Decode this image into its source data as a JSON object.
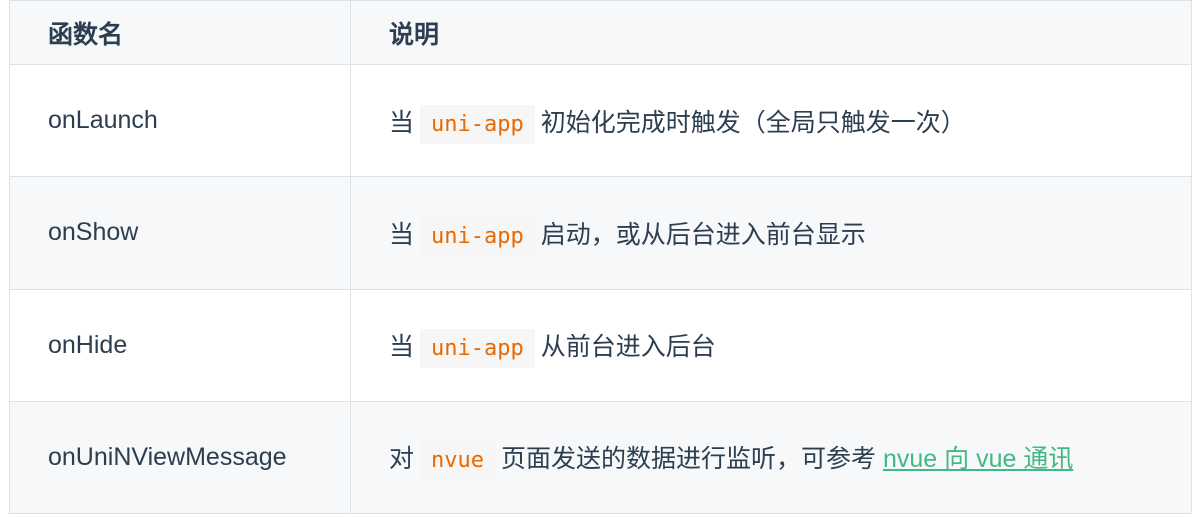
{
  "table": {
    "headers": [
      "函数名",
      "说明"
    ],
    "rows": [
      {
        "name": "onLaunch",
        "pre": "当",
        "code": "uni-app",
        "post": "初始化完成时触发（全局只触发一次）",
        "link": ""
      },
      {
        "name": "onShow",
        "pre": "当",
        "code": "uni-app",
        "post": "启动，或从后台进入前台显示",
        "link": ""
      },
      {
        "name": "onHide",
        "pre": "当",
        "code": "uni-app",
        "post": "从前台进入后台",
        "link": ""
      },
      {
        "name": "onUniNViewMessage",
        "pre": "对",
        "code": "nvue",
        "post": "页面发送的数据进行监听，可参考",
        "link": "nvue 向 vue 通讯"
      }
    ]
  },
  "colors": {
    "code_text": "#e96900",
    "code_bg": "#f6f6f6",
    "link": "#42b983",
    "border": "#dfe2e5",
    "stripe": "#f6f8fa",
    "text": "#2c3e50"
  }
}
